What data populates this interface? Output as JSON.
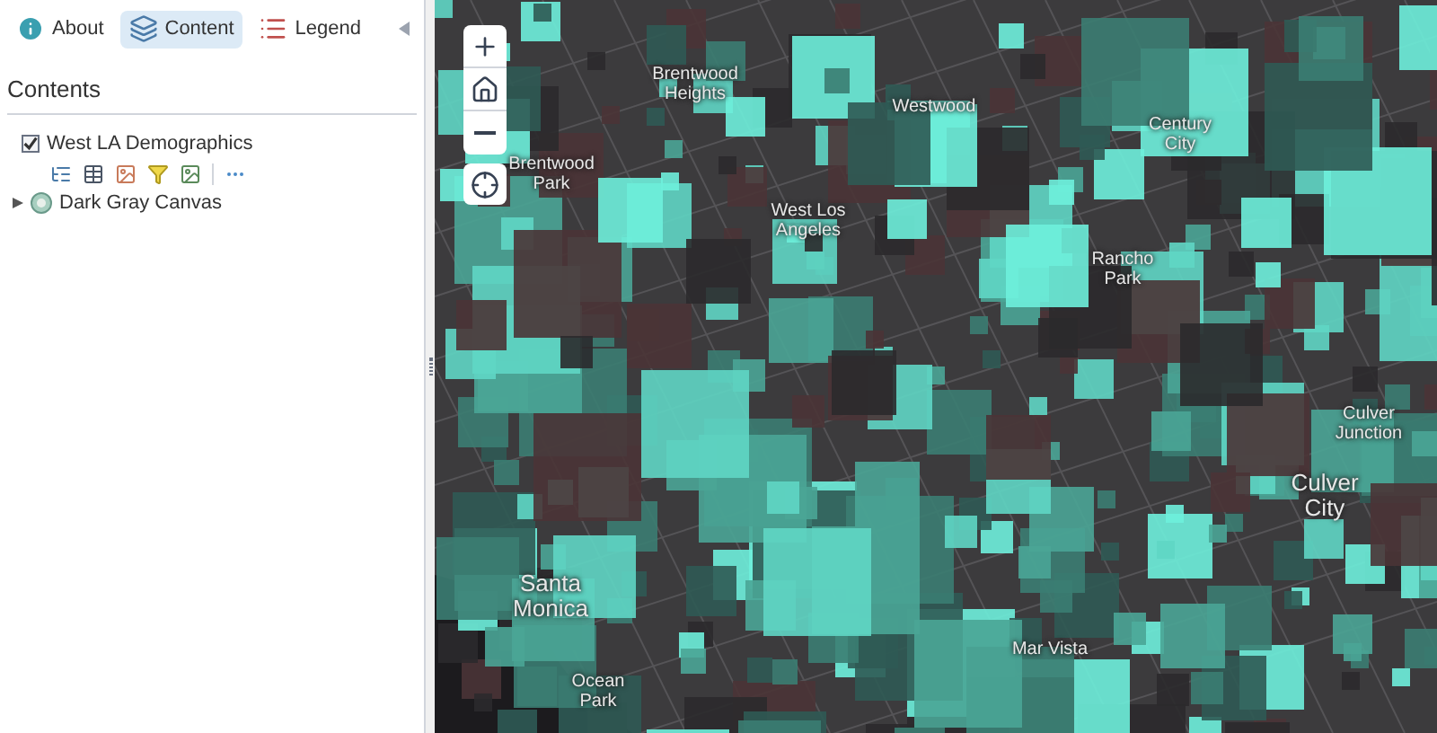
{
  "tabs": [
    {
      "label": "About",
      "kind": "info",
      "selected": false
    },
    {
      "label": "Content",
      "kind": "content",
      "selected": true
    },
    {
      "label": "Legend",
      "kind": "legend",
      "selected": false
    }
  ],
  "panel": {
    "title": "Contents"
  },
  "layers": [
    {
      "name": "West LA Demographics",
      "kind": "operational",
      "checked": true
    },
    {
      "name": "Dark Gray Canvas",
      "kind": "basemap",
      "expanded": false
    }
  ],
  "map": {
    "labels": [
      {
        "text": "Brentwood Heights"
      },
      {
        "text": "Westwood"
      },
      {
        "text": "Century City"
      },
      {
        "text": "Brentwood Park"
      },
      {
        "text": "West Los Angeles"
      },
      {
        "text": "Rancho Park"
      },
      {
        "text": "Culver Junction"
      },
      {
        "text": "Culver City"
      },
      {
        "text": "Santa Monica"
      },
      {
        "text": "Mar Vista"
      },
      {
        "text": "Ocean Park"
      }
    ]
  }
}
